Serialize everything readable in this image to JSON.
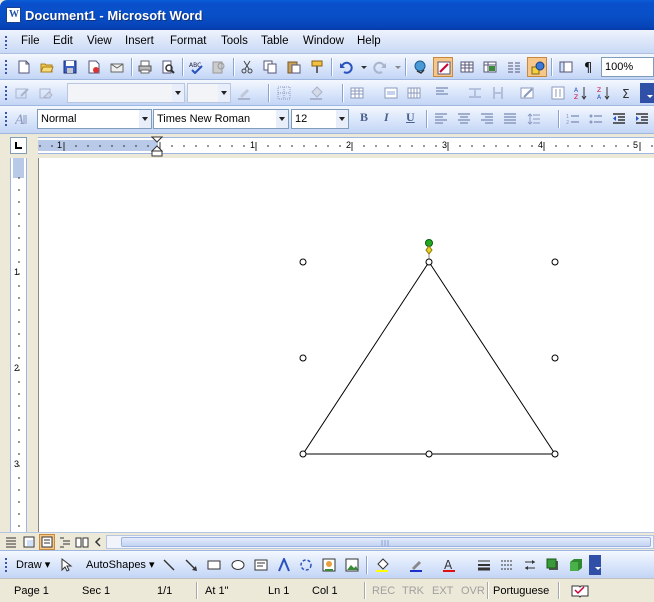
{
  "window": {
    "title": "Document1 - Microsoft Word",
    "app_icon": "W"
  },
  "menu": {
    "file": "File",
    "edit": "Edit",
    "view": "View",
    "insert": "Insert",
    "format": "Format",
    "tools": "Tools",
    "table": "Table",
    "window": "Window",
    "help": "Help"
  },
  "standard_toolbar": {
    "zoom": "100%"
  },
  "formatting_toolbar": {
    "style": "Normal",
    "font": "Times New Roman",
    "size": "12",
    "bold": "B",
    "italic": "I",
    "underline": "U"
  },
  "ruler": {
    "h_labels": [
      "1",
      "1",
      "2",
      "3",
      "4",
      "5"
    ],
    "v_labels": [
      "1",
      "2",
      "3"
    ]
  },
  "drawing_toolbar": {
    "draw": "Draw",
    "autoshapes": "AutoShapes"
  },
  "statusbar": {
    "page": "Page 1",
    "sec": "Sec 1",
    "pages": "1/1",
    "at": "At 1\"",
    "ln": "Ln 1",
    "col": "Col 1",
    "rec": "REC",
    "trk": "TRK",
    "ext": "EXT",
    "ovr": "OVR",
    "language": "Portuguese"
  },
  "colors": {
    "title_bar": "#0a4fcc",
    "selection_handle": "#ffffff",
    "rotate_handle": "#22aa22",
    "adjust_handle": "#e8d020"
  }
}
